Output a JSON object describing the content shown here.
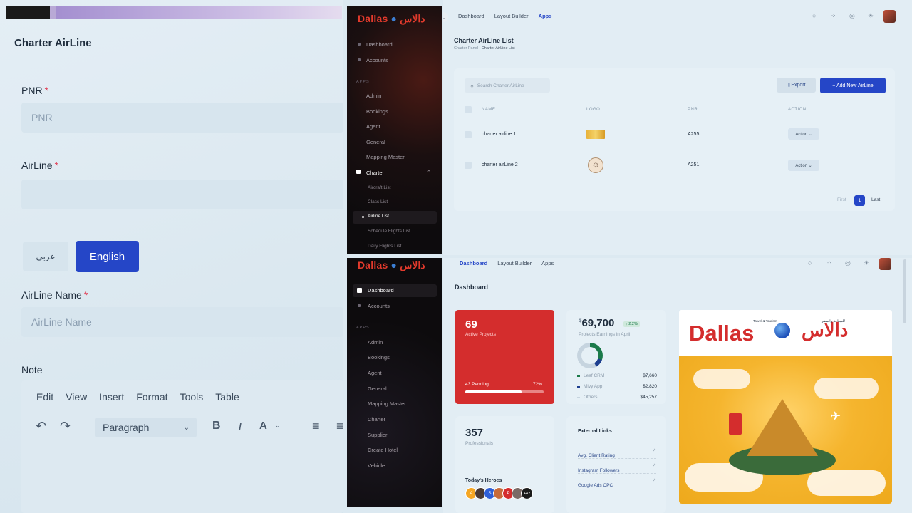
{
  "form": {
    "title": "Charter AirLine",
    "pnr_label": "PNR",
    "pnr_placeholder": "PNR",
    "airline_label": "AirLine",
    "lang_arabic": "عربي",
    "lang_english": "English",
    "airline_name_label": "AirLine Name",
    "airline_name_placeholder": "AirLine Name",
    "note_label": "Note",
    "required_mark": "*",
    "editor_menu": [
      "Edit",
      "View",
      "Insert",
      "Format",
      "Tools",
      "Table"
    ],
    "paragraph": "Paragraph"
  },
  "sidebar_top": {
    "logo_en": "Dallas",
    "logo_ar": "دالاس",
    "items": [
      "Dashboard",
      "Accounts"
    ],
    "section": "APPS",
    "apps": [
      "Admin",
      "Bookings",
      "Agent",
      "General",
      "Mapping Master",
      "Charter"
    ],
    "charter_sub": [
      "Aircraft List",
      "Class List",
      "Airline List",
      "Schedule Flights List",
      "Daily Flights List"
    ]
  },
  "list_page": {
    "nav": [
      "Dashboard",
      "Layout Builder",
      "Apps"
    ],
    "title": "Charter AirLine List",
    "breadcrumb": [
      "Charter Panel",
      "Charter AirLine List"
    ],
    "search_placeholder": "Search Charter AirLine",
    "export": "Export",
    "add_new": "+ Add New AirLine",
    "columns": [
      "NAME",
      "LOGO",
      "PNR",
      "ACTION"
    ],
    "rows": [
      {
        "name": "charter airline 1",
        "pnr": "A255",
        "action": "Action ⌄"
      },
      {
        "name": "charter airLine 2",
        "pnr": "A251",
        "action": "Action ⌄"
      }
    ],
    "pagination": {
      "first": "First",
      "page": "1",
      "last": "Last"
    }
  },
  "sidebar_bottom": {
    "logo_en": "Dallas",
    "logo_ar": "دالاس",
    "items": [
      "Dashboard",
      "Accounts"
    ],
    "section": "APPS",
    "apps": [
      "Admin",
      "Bookings",
      "Agent",
      "General",
      "Mapping Master",
      "Charter",
      "Supplier",
      "Create Hotel",
      "Vehicle"
    ]
  },
  "dashboard": {
    "nav": [
      "Dashboard",
      "Layout Builder",
      "Apps"
    ],
    "title": "Dashboard",
    "active_projects": {
      "value": "69",
      "label": "Active Projects",
      "pending": "43 Pending",
      "pct": "72%",
      "progress": 0.72
    },
    "earnings": {
      "currency": "$",
      "value": "69,700",
      "change": "↑ 2.2%",
      "label": "Projects Earnings in April",
      "legend": [
        {
          "name": "Leaf CRM",
          "value": "$7,660",
          "color": "#1b7a4a"
        },
        {
          "name": "Mivy App",
          "value": "$2,820",
          "color": "#1d3f8f"
        },
        {
          "name": "Others",
          "value": "$45,257",
          "color": "#c6d4df"
        }
      ]
    },
    "professionals": {
      "value": "357",
      "label": "Professionals",
      "heroes_title": "Today's Heroes",
      "more": "+42",
      "avatars": [
        "A",
        "S",
        "P"
      ]
    },
    "links": {
      "title": "External Links",
      "items": [
        "Avg. Client Rating",
        "Instagram Followers",
        "Google Ads CPC"
      ]
    },
    "banner": {
      "en": "Dallas",
      "ar": "دالاس",
      "tagline_en": "Travel & Tourism",
      "tagline_ar": "للسياحة والسفر"
    }
  }
}
